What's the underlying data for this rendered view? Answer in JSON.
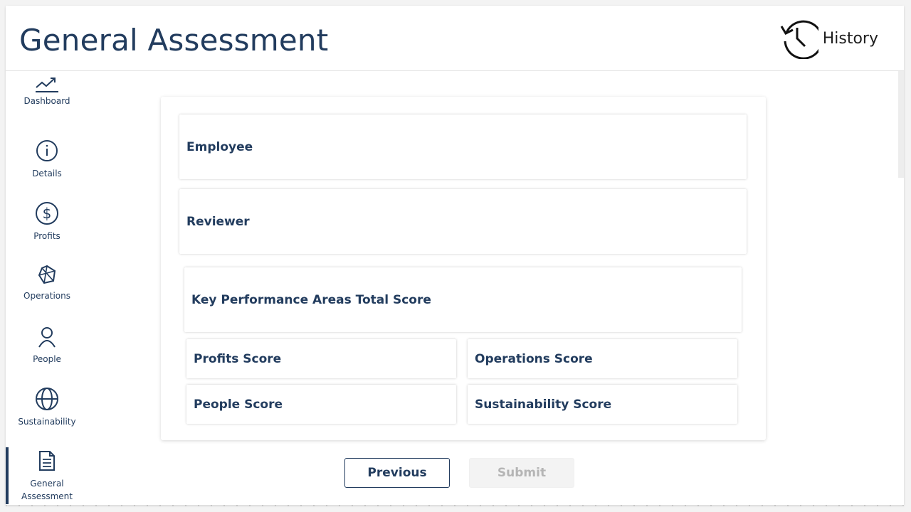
{
  "header": {
    "title": "General Assessment",
    "history_label": "History"
  },
  "sidebar": {
    "items": [
      {
        "label": "Dashboard",
        "icon": "trend-line-icon"
      },
      {
        "label": "Details",
        "icon": "info-icon"
      },
      {
        "label": "Profits",
        "icon": "dollar-icon"
      },
      {
        "label": "Operations",
        "icon": "network-icon"
      },
      {
        "label": "People",
        "icon": "person-icon"
      },
      {
        "label": "Sustainability",
        "icon": "globe-icon"
      },
      {
        "label_line1": "General",
        "label_line2": "Assessment",
        "icon": "document-icon",
        "active": true
      }
    ]
  },
  "form": {
    "employee_label": "Employee",
    "reviewer_label": "Reviewer",
    "kpa_total_label": "Key Performance Areas Total Score",
    "profits_score_label": "Profits Score",
    "operations_score_label": "Operations Score",
    "people_score_label": "People Score",
    "sustainability_score_label": "Sustainability Score"
  },
  "actions": {
    "previous_label": "Previous",
    "submit_label": "Submit"
  },
  "colors": {
    "primary": "#223c5e",
    "disabled_text": "#b5b5b5",
    "disabled_bg": "#f3f3f3"
  }
}
